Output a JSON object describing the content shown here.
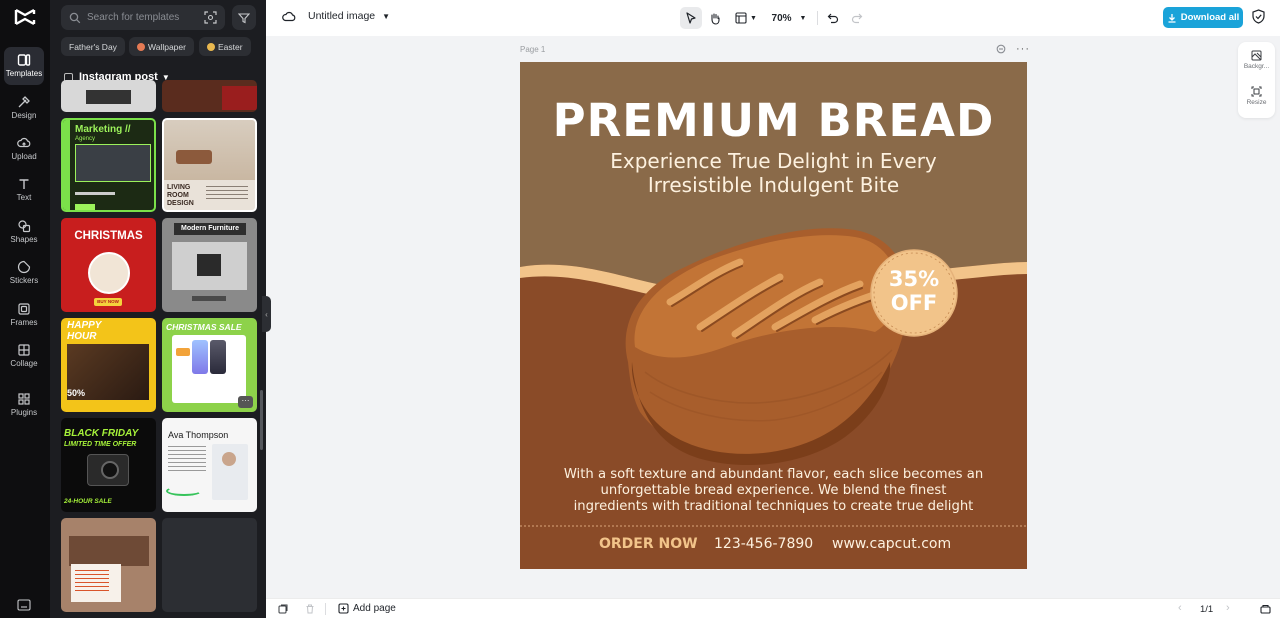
{
  "app": {
    "document_title": "Untitled image",
    "zoom": "70%",
    "download_label": "Download all"
  },
  "rail": {
    "items": [
      {
        "label": "Templates"
      },
      {
        "label": "Design"
      },
      {
        "label": "Upload"
      },
      {
        "label": "Text"
      },
      {
        "label": "Shapes"
      },
      {
        "label": "Stickers"
      },
      {
        "label": "Frames"
      },
      {
        "label": "Collage"
      },
      {
        "label": "Plugins"
      }
    ]
  },
  "panel": {
    "search_placeholder": "Search for templates",
    "chips": [
      "Father's Day",
      "Wallpaper",
      "Easter"
    ],
    "section_title": "Instagram post",
    "tiles": {
      "marketing_title": "Marketing //",
      "marketing_sub": "Agency",
      "living_room": "LIVING ROOM DESIGN",
      "christmas": "CHRISTMAS",
      "christmas_btn": "BUY NOW",
      "modern_furniture": "Modern Furniture",
      "happy_hour": "HAPPY HOUR",
      "happy_pct": "50%",
      "christmas_sale": "CHRISTMAS SALE",
      "black_friday": "BLACK FRIDAY",
      "limited_offer": "LIMITED TIME OFFER",
      "hour_sale": "24-HOUR SALE",
      "ava": "Ava Thompson"
    }
  },
  "canvas": {
    "page_label": "Page 1",
    "headline": "PREMIUM BREAD",
    "subhead_line1": "Experience True Delight in Every",
    "subhead_line2": "Irresistible Indulgent Bite",
    "badge_pct": "35%",
    "badge_off": "OFF",
    "body_line1": "With a soft texture and abundant flavor, each slice becomes an",
    "body_line2": "unforgettable bread experience. We blend the finest",
    "body_line3": "ingredients with traditional techniques to create true delight",
    "order_now": "ORDER NOW",
    "phone": "123-456-7890",
    "website": "www.capcut.com",
    "colors": {
      "top_bg": "#8a6a49",
      "bottom_bg": "#8a4b28",
      "accent": "#f2c48a",
      "text_light": "#fdf1df"
    }
  },
  "right_rail": {
    "background_label": "Backgr...",
    "resize_label": "Resize"
  },
  "bottom": {
    "add_page": "Add page",
    "pager": "1/1"
  }
}
